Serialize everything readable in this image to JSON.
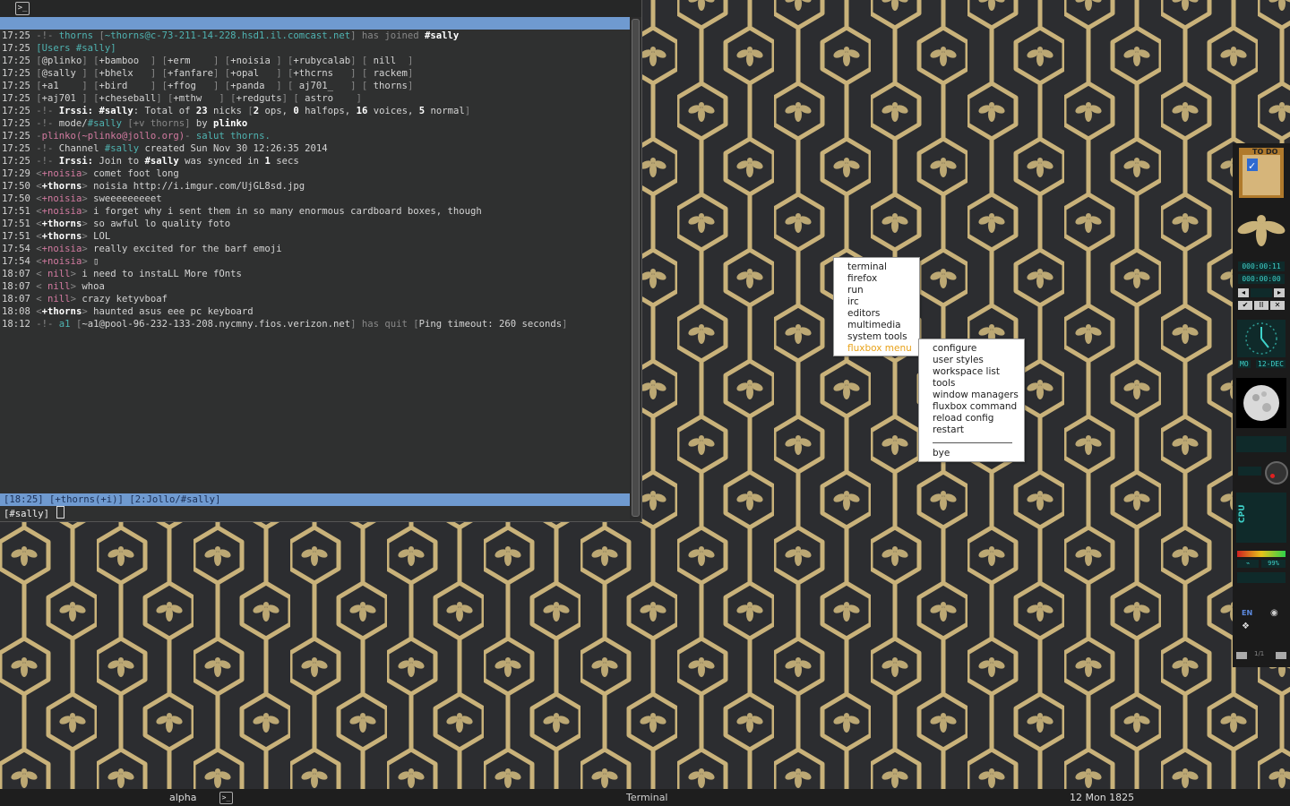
{
  "terminal": {
    "titlebar_icon": "terminal-icon",
    "lines": [
      [
        [
          "17:25 ",
          "ts"
        ],
        [
          "-!- ",
          "dim"
        ],
        [
          "thorns ",
          "teal"
        ],
        [
          "[",
          "dim"
        ],
        [
          "~thorns@c-73-211-14-228.hsd1.il.comcast.net",
          "teal"
        ],
        [
          "] has joined ",
          "dim"
        ],
        [
          "#sally",
          "bold"
        ]
      ],
      [
        [
          "17:25 ",
          "ts"
        ],
        [
          "[Users #sally]",
          "teal"
        ]
      ],
      [
        [
          "17:25 ",
          "ts"
        ],
        [
          "[",
          "dim"
        ],
        [
          "@plinko",
          "ts"
        ],
        [
          "] [",
          "dim"
        ],
        [
          "+bamboo  ",
          "ts"
        ],
        [
          "] [",
          "dim"
        ],
        [
          "+erm    ",
          "ts"
        ],
        [
          "] [",
          "dim"
        ],
        [
          "+noisia ",
          "ts"
        ],
        [
          "] [",
          "dim"
        ],
        [
          "+rubycalab",
          "ts"
        ],
        [
          "] [",
          "dim"
        ],
        [
          " nill  ",
          "ts"
        ],
        [
          "]",
          "dim"
        ]
      ],
      [
        [
          "17:25 ",
          "ts"
        ],
        [
          "[",
          "dim"
        ],
        [
          "@sally ",
          "ts"
        ],
        [
          "] [",
          "dim"
        ],
        [
          "+bhelx   ",
          "ts"
        ],
        [
          "] [",
          "dim"
        ],
        [
          "+fanfare",
          "ts"
        ],
        [
          "] [",
          "dim"
        ],
        [
          "+opal   ",
          "ts"
        ],
        [
          "] [",
          "dim"
        ],
        [
          "+thcrns   ",
          "ts"
        ],
        [
          "] [",
          "dim"
        ],
        [
          " rackem",
          "ts"
        ],
        [
          "]",
          "dim"
        ]
      ],
      [
        [
          "17:25 ",
          "ts"
        ],
        [
          "[",
          "dim"
        ],
        [
          "+a1    ",
          "ts"
        ],
        [
          "] [",
          "dim"
        ],
        [
          "+bird    ",
          "ts"
        ],
        [
          "] [",
          "dim"
        ],
        [
          "+ffog   ",
          "ts"
        ],
        [
          "] [",
          "dim"
        ],
        [
          "+panda  ",
          "ts"
        ],
        [
          "] [",
          "dim"
        ],
        [
          " aj701_   ",
          "ts"
        ],
        [
          "] [",
          "dim"
        ],
        [
          " thorns",
          "ts"
        ],
        [
          "]",
          "dim"
        ]
      ],
      [
        [
          "17:25 ",
          "ts"
        ],
        [
          "[",
          "dim"
        ],
        [
          "+aj701 ",
          "ts"
        ],
        [
          "] [",
          "dim"
        ],
        [
          "+cheseball",
          "ts"
        ],
        [
          "] [",
          "dim"
        ],
        [
          "+mthw   ",
          "ts"
        ],
        [
          "] [",
          "dim"
        ],
        [
          "+redguts",
          "ts"
        ],
        [
          "] [",
          "dim"
        ],
        [
          " astro    ",
          "ts"
        ],
        [
          "]",
          "dim"
        ]
      ],
      [
        [
          "17:25 ",
          "ts"
        ],
        [
          "-!- ",
          "dim"
        ],
        [
          "Irssi: ",
          "bold"
        ],
        [
          "#sally",
          "bold"
        ],
        [
          ": Total of ",
          "ts"
        ],
        [
          "23",
          "bold"
        ],
        [
          " nicks ",
          "ts"
        ],
        [
          "[",
          "dim"
        ],
        [
          "2",
          "bold"
        ],
        [
          " ops, ",
          "ts"
        ],
        [
          "0",
          "bold"
        ],
        [
          " halfops, ",
          "ts"
        ],
        [
          "16",
          "bold"
        ],
        [
          " voices, ",
          "ts"
        ],
        [
          "5",
          "bold"
        ],
        [
          " normal",
          "ts"
        ],
        [
          "]",
          "dim"
        ]
      ],
      [
        [
          "17:25 ",
          "ts"
        ],
        [
          "-!- ",
          "dim"
        ],
        [
          "mode/",
          "ts"
        ],
        [
          "#sally ",
          "teal"
        ],
        [
          "[+v thorns] ",
          "dim"
        ],
        [
          "by ",
          "ts"
        ],
        [
          "plinko",
          "bold"
        ]
      ],
      [
        [
          "17:25 ",
          "ts"
        ],
        [
          "-",
          "dim"
        ],
        [
          "plinko",
          "pink"
        ],
        [
          "(~plinko@jollo.org)",
          "pink"
        ],
        [
          "- ",
          "dim"
        ],
        [
          "salut thorns.",
          "teal"
        ]
      ],
      [
        [
          "17:25 ",
          "ts"
        ],
        [
          "-!- ",
          "dim"
        ],
        [
          "Channel ",
          "ts"
        ],
        [
          "#sally",
          "teal"
        ],
        [
          " created Sun Nov 30 12:26:35 2014",
          "ts"
        ]
      ],
      [
        [
          "17:25 ",
          "ts"
        ],
        [
          "-!- ",
          "dim"
        ],
        [
          "Irssi: ",
          "bold"
        ],
        [
          "Join to ",
          "ts"
        ],
        [
          "#sally",
          "bold"
        ],
        [
          " was synced in ",
          "ts"
        ],
        [
          "1",
          "bold"
        ],
        [
          " secs",
          "ts"
        ]
      ],
      [
        [
          "17:29 ",
          "ts"
        ],
        [
          "<",
          "dim"
        ],
        [
          "+noisia",
          "pink"
        ],
        [
          "> ",
          "dim"
        ],
        [
          "comet foot long",
          "ts"
        ]
      ],
      [
        [
          "17:50 ",
          "ts"
        ],
        [
          "<",
          "dim"
        ],
        [
          "+thorns",
          "bold"
        ],
        [
          "> ",
          "dim"
        ],
        [
          "noisia http://i.imgur.com/UjGL8sd.jpg",
          "ts"
        ]
      ],
      [
        [
          "17:50 ",
          "ts"
        ],
        [
          "<",
          "dim"
        ],
        [
          "+noisia",
          "pink"
        ],
        [
          "> ",
          "dim"
        ],
        [
          "sweeeeeeeeet",
          "ts"
        ]
      ],
      [
        [
          "17:51 ",
          "ts"
        ],
        [
          "<",
          "dim"
        ],
        [
          "+noisia",
          "pink"
        ],
        [
          "> ",
          "dim"
        ],
        [
          "i forget why i sent them in so many enormous cardboard boxes, though",
          "ts"
        ]
      ],
      [
        [
          "17:51 ",
          "ts"
        ],
        [
          "<",
          "dim"
        ],
        [
          "+thorns",
          "bold"
        ],
        [
          "> ",
          "dim"
        ],
        [
          "so awful lo quality foto",
          "ts"
        ]
      ],
      [
        [
          "17:51 ",
          "ts"
        ],
        [
          "<",
          "dim"
        ],
        [
          "+thorns",
          "bold"
        ],
        [
          "> ",
          "dim"
        ],
        [
          "LOL",
          "ts"
        ]
      ],
      [
        [
          "17:54 ",
          "ts"
        ],
        [
          "<",
          "dim"
        ],
        [
          "+noisia",
          "pink"
        ],
        [
          "> ",
          "dim"
        ],
        [
          "really excited for the barf emoji",
          "ts"
        ]
      ],
      [
        [
          "17:54 ",
          "ts"
        ],
        [
          "<",
          "dim"
        ],
        [
          "+noisia",
          "pink"
        ],
        [
          "> ",
          "dim"
        ],
        [
          "▯",
          "ts"
        ]
      ],
      [
        [
          "18:07 ",
          "ts"
        ],
        [
          "< ",
          "dim"
        ],
        [
          "nill",
          "pink"
        ],
        [
          "> ",
          "dim"
        ],
        [
          "i need to instaLL More fOnts",
          "ts"
        ]
      ],
      [
        [
          "18:07 ",
          "ts"
        ],
        [
          "< ",
          "dim"
        ],
        [
          "nill",
          "pink"
        ],
        [
          "> ",
          "dim"
        ],
        [
          "whoa",
          "ts"
        ]
      ],
      [
        [
          "18:07 ",
          "ts"
        ],
        [
          "< ",
          "dim"
        ],
        [
          "nill",
          "pink"
        ],
        [
          "> ",
          "dim"
        ],
        [
          "crazy ketyvboaf",
          "ts"
        ]
      ],
      [
        [
          "18:08 ",
          "ts"
        ],
        [
          "<",
          "dim"
        ],
        [
          "+thorns",
          "bold"
        ],
        [
          "> ",
          "dim"
        ],
        [
          "haunted asus eee pc keyboard",
          "ts"
        ]
      ],
      [
        [
          "18:12 ",
          "ts"
        ],
        [
          "-!- ",
          "dim"
        ],
        [
          "a1 ",
          "teal"
        ],
        [
          "[",
          "dim"
        ],
        [
          "~a1@pool-96-232-133-208.nycmny.fios.verizon.net",
          "ts"
        ],
        [
          "] has quit ",
          "dim"
        ],
        [
          "[",
          "dim"
        ],
        [
          "Ping timeout: 260 seconds",
          "ts"
        ],
        [
          "]",
          "dim"
        ]
      ]
    ],
    "status_bar": "[18:25] [+thorns(+i)] [2:Jollo/#sally]",
    "input_prompt": "[#sally] "
  },
  "root_menu": {
    "items": [
      "terminal",
      "firefox",
      "run",
      "irc",
      "editors",
      "multimedia",
      "system tools",
      "fluxbox menu"
    ],
    "active_index": 7
  },
  "fluxbox_submenu": {
    "items": [
      "configure",
      "user styles",
      "workspace list",
      "tools",
      "window managers",
      "fluxbox command",
      "reload config",
      "restart"
    ],
    "after_separator": "bye"
  },
  "dockapps": {
    "todo_label": "TO DO",
    "timer_1": "000:00:11",
    "timer_2": "000:00:00",
    "date_day": "MO",
    "date": "12-DEC",
    "cpu_label": "CPU",
    "battery_percent": "99%",
    "battery_level": 0.99,
    "lang": "EN",
    "workspace_counter": "1/1",
    "icons": [
      "todo-icon",
      "bee-icon",
      "clock-icon",
      "moon-icon",
      "cpu-icon",
      "battery-icon",
      "network-icon",
      "dropbox-icon"
    ]
  },
  "toolbar": {
    "workspace": "alpha",
    "task_icon": "terminal-icon",
    "task_title": "Terminal",
    "clock": "12 Mon 1825"
  },
  "colors": {
    "wallpaper_bg": "#2c2d30",
    "honeycomb_gold": "#c9b27a",
    "irssi_bar": "#6f9ad0",
    "menu_active": "#e8a21a"
  }
}
